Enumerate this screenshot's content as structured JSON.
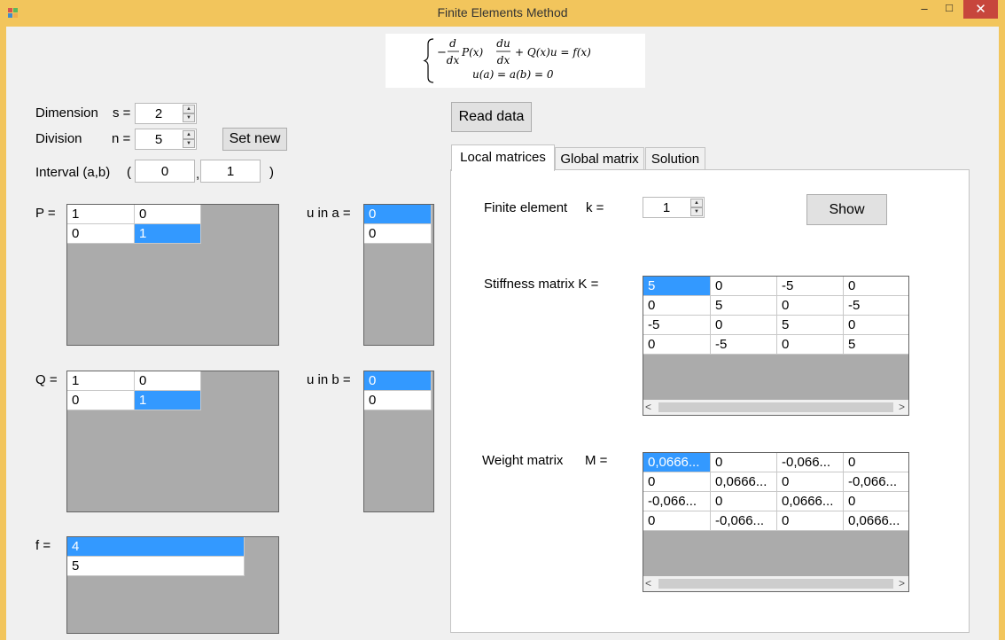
{
  "window": {
    "title": "Finite Elements Method",
    "minimize": "–",
    "maximize": "□",
    "close": "✕"
  },
  "icons": {
    "app": "app-icon",
    "minimize": "minimize-icon",
    "maximize": "maximize-icon",
    "close": "close-icon"
  },
  "colors": {
    "titlebar": "#f2c55c",
    "selection": "#3399ff",
    "grid_bg": "#ababab",
    "close_button": "#c7463c"
  },
  "formula": {
    "line1": "−(d/dx) P(x) du/dx + Q(x)u = f(x)",
    "line2": "u(a) = a(b) = 0"
  },
  "params": {
    "dimension_label": "Dimension",
    "s_label": "s =",
    "s_value": "2",
    "division_label": "Division",
    "n_label": "n =",
    "n_value": "5",
    "set_new": "Set new",
    "interval_label": "Interval (a,b)",
    "interval_open": "(",
    "interval_a": "0",
    "interval_comma": ",",
    "interval_b": "1",
    "interval_close": ")"
  },
  "read_data": "Read data",
  "P": {
    "label": "P =",
    "rows": [
      [
        "1",
        "0"
      ],
      [
        "0",
        "1"
      ]
    ]
  },
  "Q": {
    "label": "Q =",
    "rows": [
      [
        "1",
        "0"
      ],
      [
        "0",
        "1"
      ]
    ]
  },
  "f": {
    "label": "f =",
    "rows": [
      [
        "4"
      ],
      [
        "5"
      ]
    ]
  },
  "ua": {
    "label": "u in a =",
    "rows": [
      [
        "0"
      ],
      [
        "0"
      ]
    ]
  },
  "ub": {
    "label": "u in b =",
    "rows": [
      [
        "0"
      ],
      [
        "0"
      ]
    ]
  },
  "tabs": [
    "Local matrices",
    "Global matrix",
    "Solution"
  ],
  "local": {
    "fe_label": "Finite element",
    "k_label": "k =",
    "k_value": "1",
    "show": "Show",
    "stiffness_label": "Stiffness matrix  K =",
    "stiffness": [
      [
        "5",
        "0",
        "-5",
        "0"
      ],
      [
        "0",
        "5",
        "0",
        "-5"
      ],
      [
        "-5",
        "0",
        "5",
        "0"
      ],
      [
        "0",
        "-5",
        "0",
        "5"
      ]
    ],
    "weight_label": "Weight matrix",
    "m_label": "M =",
    "weight": [
      [
        "0,0666...",
        "0",
        "-0,066...",
        "0"
      ],
      [
        "0",
        "0,0666...",
        "0",
        "-0,066..."
      ],
      [
        "-0,066...",
        "0",
        "0,0666...",
        "0"
      ],
      [
        "0",
        "-0,066...",
        "0",
        "0,0666..."
      ]
    ]
  }
}
